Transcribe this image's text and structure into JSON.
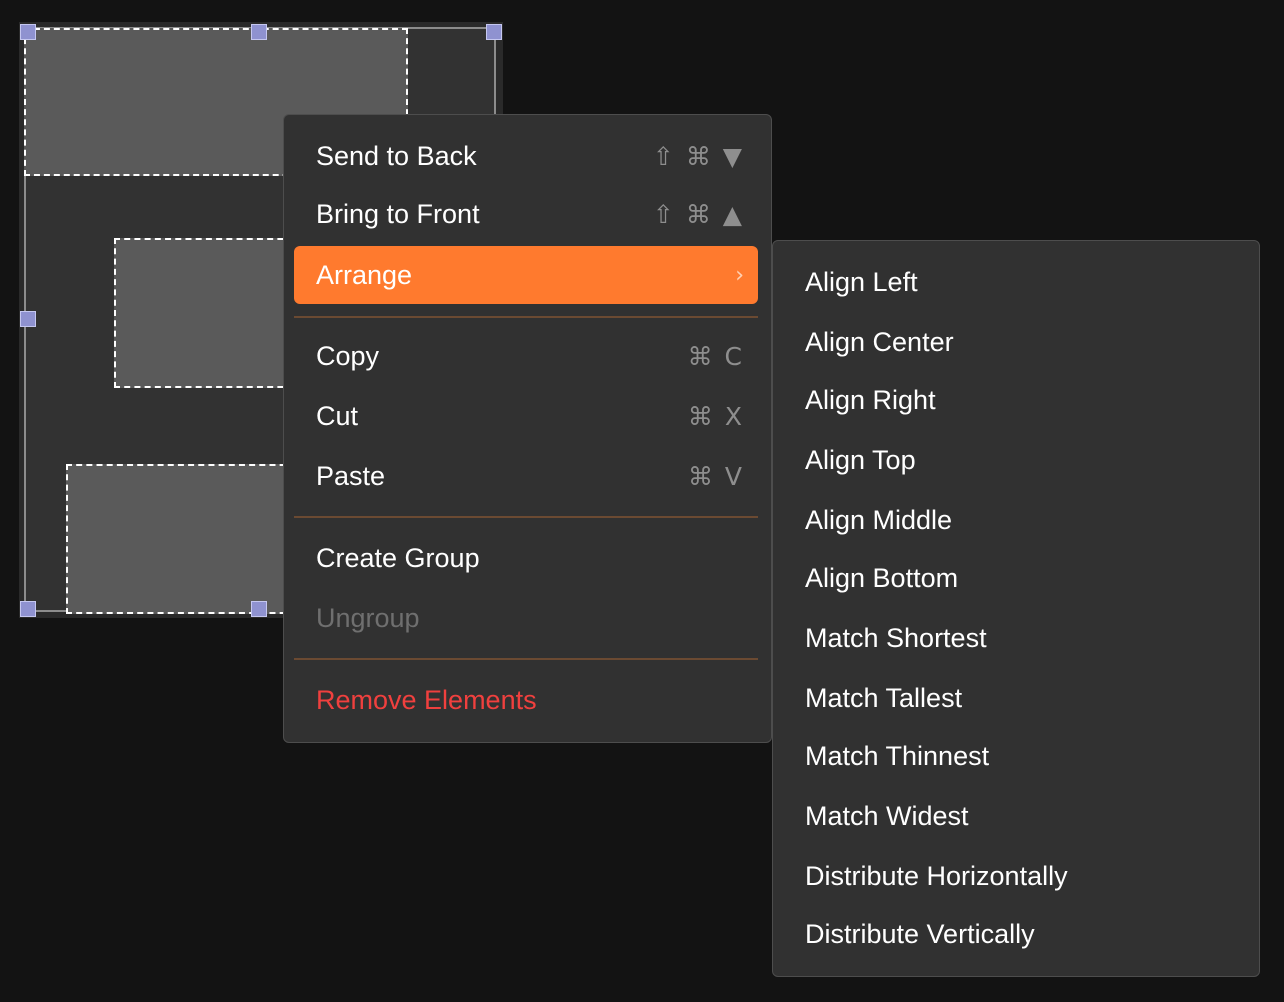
{
  "context_menu": {
    "items": [
      {
        "label": "Send to Back",
        "shortcut": "⇧ ⌘ ▼"
      },
      {
        "label": "Bring to Front",
        "shortcut": "⇧ ⌘ ▲"
      },
      {
        "label": "Arrange",
        "chevron": "›"
      },
      {
        "label": "Copy",
        "shortcut": "⌘ C"
      },
      {
        "label": "Cut",
        "shortcut": "⌘ X"
      },
      {
        "label": "Paste",
        "shortcut": "⌘ V"
      },
      {
        "label": "Create Group"
      },
      {
        "label": "Ungroup"
      },
      {
        "label": "Remove Elements"
      }
    ]
  },
  "arrange_submenu": {
    "items": [
      {
        "label": "Align Left"
      },
      {
        "label": "Align Center"
      },
      {
        "label": "Align Right"
      },
      {
        "label": "Align Top"
      },
      {
        "label": "Align Middle"
      },
      {
        "label": "Align Bottom"
      },
      {
        "label": "Match Shortest"
      },
      {
        "label": "Match Tallest"
      },
      {
        "label": "Match Thinnest"
      },
      {
        "label": "Match Widest"
      },
      {
        "label": "Distribute Horizontally"
      },
      {
        "label": "Distribute Vertically"
      }
    ]
  },
  "colors": {
    "highlight": "#ff7a2e",
    "danger": "#f0403e",
    "disabled": "#6f6f6f",
    "handle": "#8f92d0"
  }
}
